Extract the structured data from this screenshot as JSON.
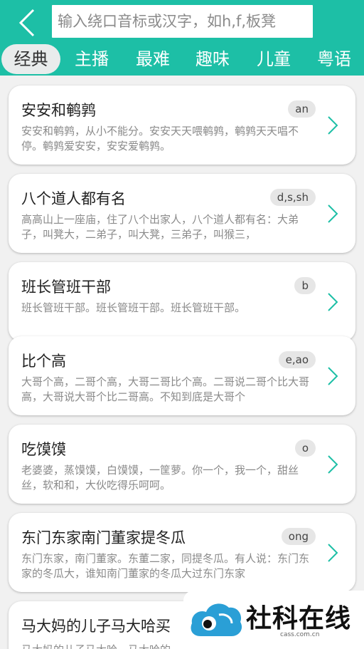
{
  "header": {
    "search_placeholder": "输入绕口音标或汉字，如h,f,板凳"
  },
  "tabs": [
    "经典",
    "主播",
    "最难",
    "趣味",
    "儿童",
    "粤语"
  ],
  "active_tab": 0,
  "items": [
    {
      "title": "安安和鹌鹑",
      "tag": "an",
      "desc": "安安和鹌鹑，从小不能分。安安天天喂鹌鹑，鹌鹑天天唱不停。鹌鹑爱安安，安安爱鹌鹑。"
    },
    {
      "title": "八个道人都有名",
      "tag": "d,s,sh",
      "desc": "高高山上一座庙，住了八个出家人，八个道人都有名：大弟子，叫凳大，二弟子，叫大凳，三弟子，叫猴三，"
    },
    {
      "title": "班长管班干部",
      "tag": "b",
      "desc": "班长管班干部。班长管班干部。班长管班干部。"
    },
    {
      "title": "比个高",
      "tag": "e,ao",
      "desc": "大哥个高，二哥个高，大哥二哥比个高。二哥说二哥个比大哥高，大哥说大哥个比二哥高。不知到底是大哥个"
    },
    {
      "title": "吃馍馍",
      "tag": "o",
      "desc": "老婆婆，蒸馍馍，白馍馍，一筐萝。你一个，我一个，甜丝丝，软和和，大伙吃得乐呵呵。"
    },
    {
      "title": "东门东家南门董家提冬瓜",
      "tag": "ong",
      "desc": "东门东家，南门董家。东董二家，同提冬瓜。有人说：东门东家的冬瓜大，谁知南门董家的冬瓜大过东门东家"
    },
    {
      "title": "马大妈的儿子马大哈买",
      "tag": "",
      "desc": "马大妈的儿子马大哈，马大哈的"
    }
  ],
  "watermark": {
    "title": "社科在线",
    "url": "cass.com.cn"
  },
  "colors": {
    "accent": "#1dbfa6",
    "background": "#f1f1f1"
  }
}
